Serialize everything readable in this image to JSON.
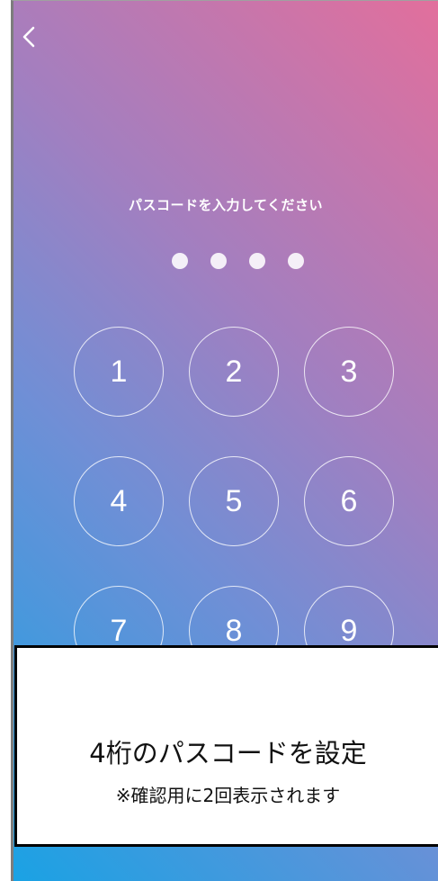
{
  "screen": {
    "prompt": "パスコードを入力してください",
    "pin_dots": 4,
    "back_icon": "chevron-left-icon"
  },
  "keypad": {
    "keys": [
      "1",
      "2",
      "3",
      "4",
      "5",
      "6",
      "7",
      "8",
      "9"
    ]
  },
  "overlay": {
    "title": "4桁のパスコードを設定",
    "note": "※確認用に2回表示されます"
  },
  "colors": {
    "gradient_top_right": "#e26f9c",
    "gradient_mid": "#a27fc0",
    "gradient_bottom_left": "#1aa2e4",
    "text": "#ffffff"
  }
}
